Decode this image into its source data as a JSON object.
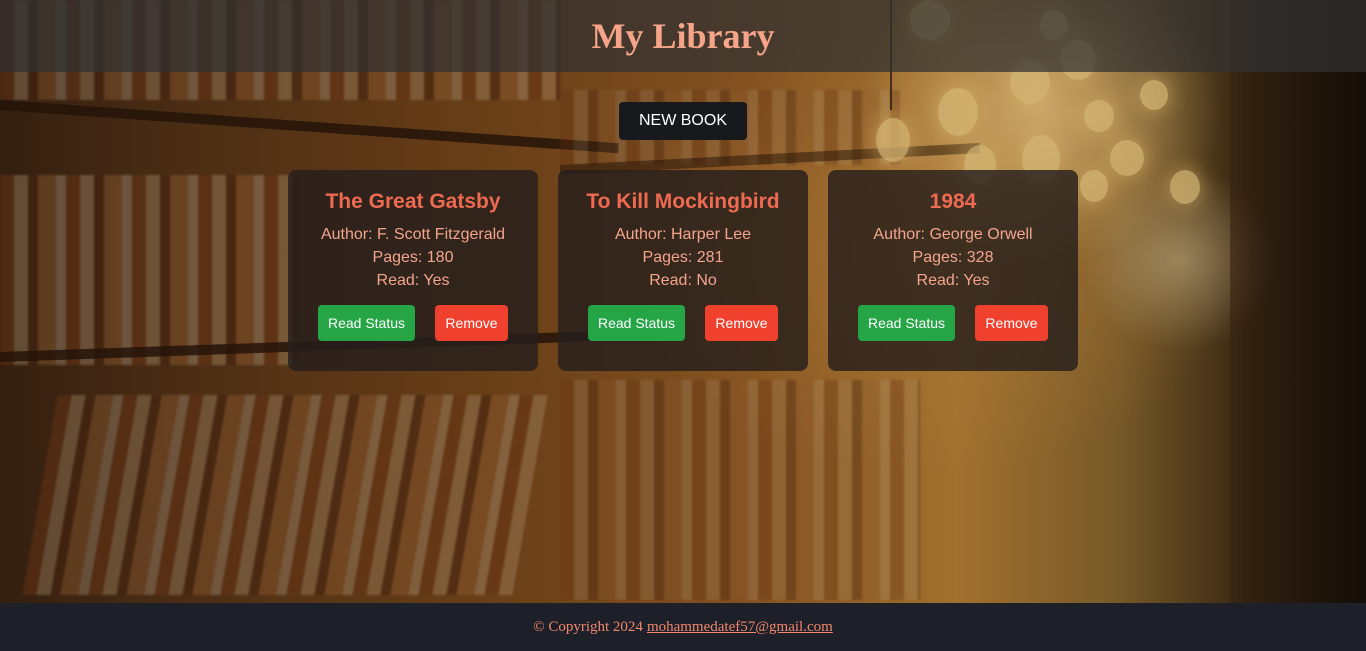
{
  "header": {
    "title": "My Library"
  },
  "actions": {
    "new_book_label": "NEW BOOK"
  },
  "books": [
    {
      "title": "The Great Gatsby",
      "author_label": "Author:",
      "author": "F. Scott Fitzgerald",
      "pages_label": "Pages:",
      "pages": "180",
      "read_label": "Read:",
      "read": "Yes",
      "status_button": "Read Status",
      "remove_button": "Remove"
    },
    {
      "title": "To Kill Mockingbird",
      "author_label": "Author:",
      "author": "Harper Lee",
      "pages_label": "Pages:",
      "pages": "281",
      "read_label": "Read:",
      "read": "No",
      "status_button": "Read Status",
      "remove_button": "Remove"
    },
    {
      "title": "1984",
      "author_label": "Author:",
      "author": "George Orwell",
      "pages_label": "Pages:",
      "pages": "328",
      "read_label": "Read:",
      "read": "Yes",
      "status_button": "Read Status",
      "remove_button": "Remove"
    }
  ],
  "footer": {
    "copyright": "© Copyright 2024",
    "email": "mohammedatef57@gmail.com"
  },
  "colors": {
    "title": "#f7a58a",
    "card_title": "#ee6a50",
    "card_text": "#f3a58c",
    "status_button": "#25a546",
    "remove_button": "#f0412f",
    "new_book_button": "#17191c",
    "footer_bg": "#1d2029"
  }
}
